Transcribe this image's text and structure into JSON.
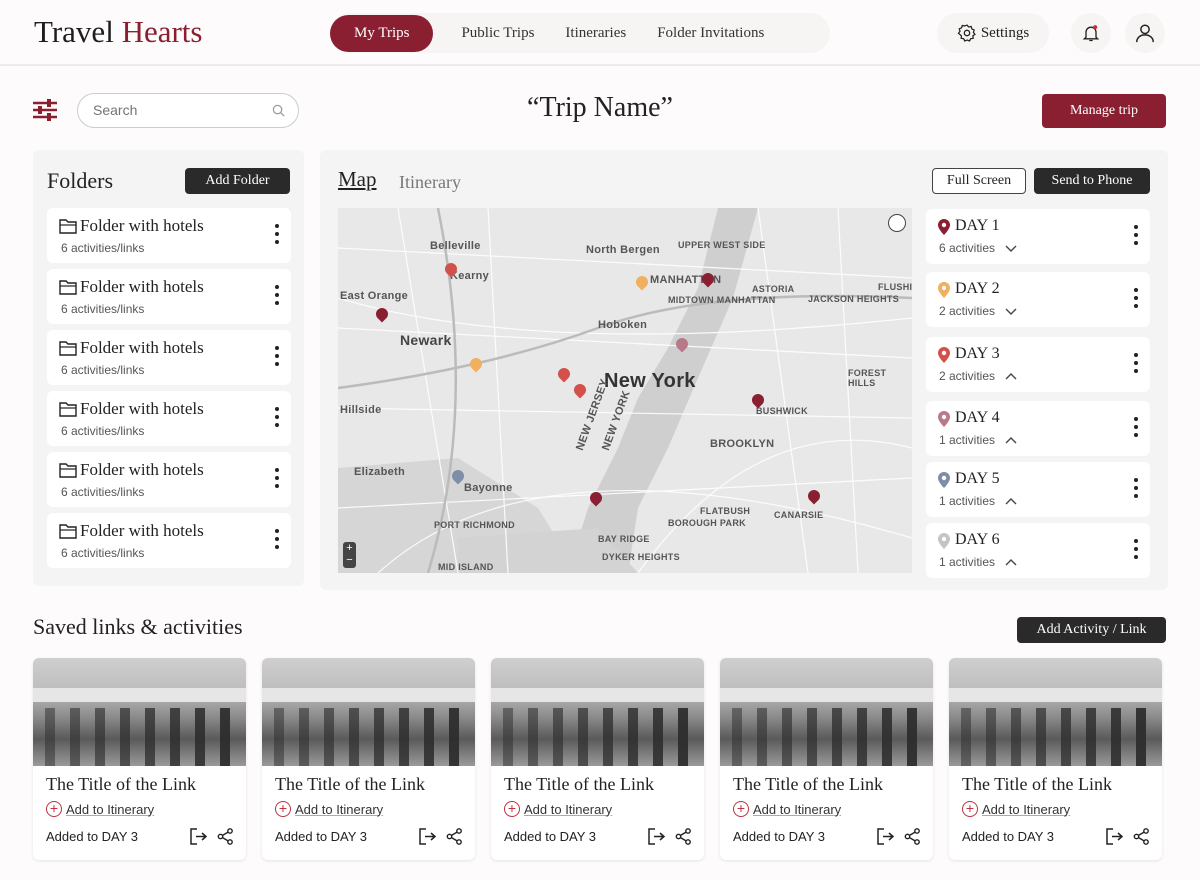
{
  "app": {
    "logo_part1": "Travel",
    "logo_part2": "Hearts"
  },
  "nav": {
    "items": [
      "My Trips",
      "Public Trips",
      "Itineraries",
      "Folder Invitations"
    ],
    "active": "My Trips",
    "settings": "Settings"
  },
  "toolbar": {
    "search_placeholder": "Search",
    "trip_name": "“Trip Name”",
    "manage_trip": "Manage trip"
  },
  "folders": {
    "title": "Folders",
    "add_label": "Add  Folder",
    "items": [
      {
        "name": "Folder with hotels",
        "count": "6 activities/links"
      },
      {
        "name": "Folder with hotels",
        "count": "6 activities/links"
      },
      {
        "name": "Folder with hotels",
        "count": "6 activities/links"
      },
      {
        "name": "Folder with hotels",
        "count": "6 activities/links"
      },
      {
        "name": "Folder with hotels",
        "count": "6 activities/links"
      },
      {
        "name": "Folder with hotels",
        "count": "6 activities/links"
      }
    ]
  },
  "map_panel": {
    "tab_map": "Map",
    "tab_itinerary": "Itinerary",
    "full_screen": "Full Screen",
    "send_to_phone": "Send to Phone",
    "labels": [
      "New York",
      "Newark",
      "BROOKLYN",
      "Hoboken",
      "MANHATTAN",
      "MIDTOWN MANHATTAN",
      "ASTORIA",
      "JACKSON HEIGHTS",
      "Belleville",
      "Kearny",
      "East Orange",
      "North Bergen",
      "UPPER WEST SIDE",
      "Hillside",
      "Elizabeth",
      "Bayonne",
      "NEW JERSEY",
      "NEW YORK",
      "BUSHWICK",
      "FLATBUSH",
      "CANARSIE",
      "BOROUGH PARK",
      "BAY RIDGE",
      "DYKER HEIGHTS",
      "PORT RICHMOND",
      "MID ISLAND",
      "FOREST HILLS",
      "FLUSHI"
    ],
    "days": [
      {
        "label": "DAY 1",
        "count": "6 activities",
        "color": "#8a1f32",
        "expanded": false
      },
      {
        "label": "DAY 2",
        "count": "2 activities",
        "color": "#f0b060",
        "expanded": false
      },
      {
        "label": "DAY 3",
        "count": "2 activities",
        "color": "#d2514a",
        "expanded": true
      },
      {
        "label": "DAY 4",
        "count": "1 activities",
        "color": "#b87a88",
        "expanded": true
      },
      {
        "label": "DAY 5",
        "count": "1 activities",
        "color": "#7d8fa6",
        "expanded": true
      },
      {
        "label": "DAY 6",
        "count": "1 activities",
        "color": "#c4c4c4",
        "expanded": true
      }
    ]
  },
  "saved": {
    "title": "Saved links & activities",
    "add_label": "Add Activity / Link",
    "cards": [
      {
        "title": "The Title of the Link",
        "add": "Add to Itinerary",
        "added": "Added to DAY 3"
      },
      {
        "title": "The Title of the Link",
        "add": "Add to Itinerary",
        "added": "Added to DAY 3"
      },
      {
        "title": "The Title of the Link",
        "add": "Add to Itinerary",
        "added": "Added to DAY 3"
      },
      {
        "title": "The Title of the Link",
        "add": "Add to Itinerary",
        "added": "Added to DAY 3"
      },
      {
        "title": "The Title of the Link",
        "add": "Add to Itinerary",
        "added": "Added to DAY 3"
      }
    ]
  },
  "colors": {
    "brand": "#8a1f32",
    "dark_button": "#2a2a2a"
  }
}
